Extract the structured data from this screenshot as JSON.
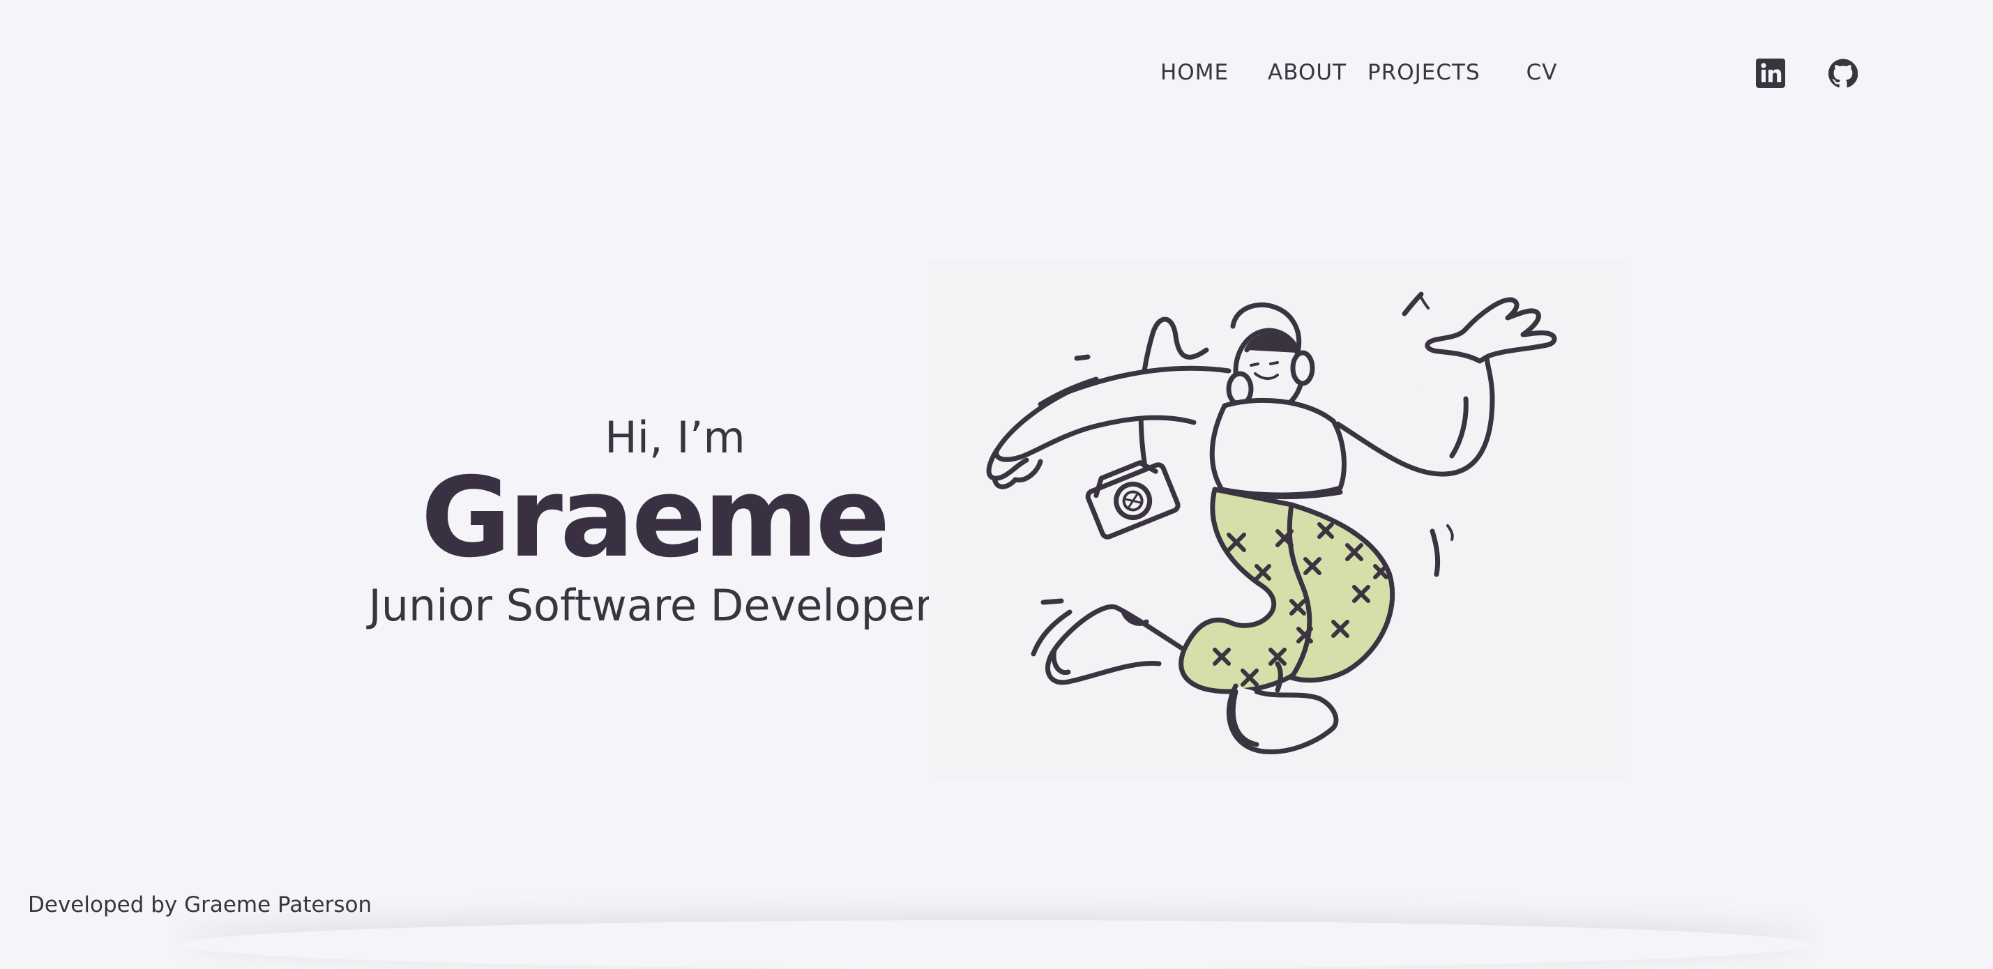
{
  "nav": {
    "items": [
      {
        "label": "HOME"
      },
      {
        "label": "ABOUT"
      },
      {
        "label": "PROJECTS"
      },
      {
        "label": "CV"
      }
    ]
  },
  "social": {
    "icons": [
      "linkedin-icon",
      "github-icon"
    ]
  },
  "hero": {
    "greeting": "Hi, I’m",
    "name": "Graeme",
    "role": "Junior Software Developer",
    "illustration": "dancing-person-illustration"
  },
  "colors": {
    "background": "#f5f5f9",
    "ink": "#3a3340",
    "pants": "#d6deaa"
  },
  "footer": {
    "text": "Developed by Graeme Paterson"
  }
}
